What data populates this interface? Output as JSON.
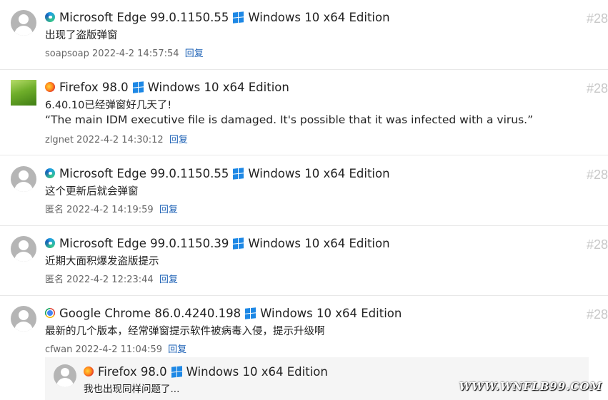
{
  "comments": [
    {
      "browser": "Microsoft Edge 99.0.1150.55",
      "browser_icon": "edge-icon",
      "os": "Windows 10 x64 Edition",
      "content": "出现了盗版弹窗",
      "author": "soapsoap",
      "date": "2022-4-2 14:57:54",
      "reply": "回复",
      "number": "#28"
    },
    {
      "browser": "Firefox 98.0",
      "browser_icon": "firefox-icon",
      "os": "Windows 10 x64 Edition",
      "content": "6.40.10已经弹窗好几天了!",
      "content2": "“The main IDM executive file is damaged. It's possible that it was infected with a virus.”",
      "author": "zlgnet",
      "date": "2022-4-2 14:30:12",
      "reply": "回复",
      "number": "#28"
    },
    {
      "browser": "Microsoft Edge 99.0.1150.55",
      "browser_icon": "edge-icon",
      "os": "Windows 10 x64 Edition",
      "content": "这个更新后就会弹窗",
      "author": "匿名",
      "date": "2022-4-2 14:19:59",
      "reply": "回复",
      "number": "#28"
    },
    {
      "browser": "Microsoft Edge 99.0.1150.39",
      "browser_icon": "edge-icon",
      "os": "Windows 10 x64 Edition",
      "content": "近期大面积爆发盗版提示",
      "author": "匿名",
      "date": "2022-4-2 12:23:44",
      "reply": "回复",
      "number": "#28"
    },
    {
      "browser": "Google Chrome 86.0.4240.198",
      "browser_icon": "chrome-icon",
      "os": "Windows 10 x64 Edition",
      "content": "最新的几个版本，经常弹窗提示软件被病毒入侵，提示升级啊",
      "author": "cfwan",
      "date": "2022-4-2 11:04:59",
      "reply": "回复",
      "number": "#28"
    }
  ],
  "nested_reply": {
    "browser": "Firefox 98.0",
    "browser_icon": "firefox-icon",
    "os": "Windows 10 x64 Edition",
    "content": "我也出现同样问题了..."
  },
  "watermark": "WWW.WNFLB99.COM",
  "colors": {
    "link": "#1a5fb4",
    "number": "#c8c8c8",
    "meta": "#666666",
    "windows": "#1e88e5"
  }
}
